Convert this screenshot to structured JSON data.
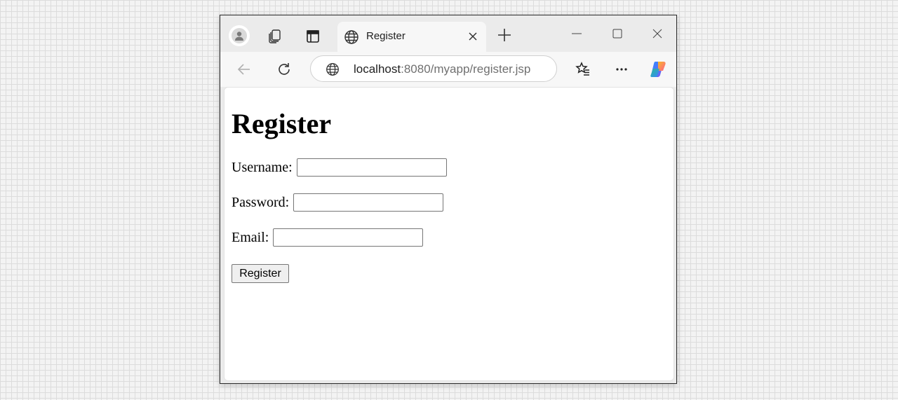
{
  "browser": {
    "tab": {
      "title": "Register"
    },
    "address": {
      "host": "localhost",
      "rest": ":8080/myapp/register.jsp"
    }
  },
  "page": {
    "heading": "Register",
    "fields": [
      {
        "label": "Username:",
        "value": ""
      },
      {
        "label": "Password:",
        "value": ""
      },
      {
        "label": "Email:",
        "value": ""
      }
    ],
    "submit_label": "Register"
  },
  "colors": {
    "window_border": "#2b2b2b",
    "tab_active": "#f7f7f7",
    "copilot_accent": "#7b5cf0"
  },
  "icons": [
    "profile-icon",
    "workspaces-icon",
    "vertical-tabs-icon",
    "globe-icon",
    "close-icon",
    "plus-icon",
    "minimize-icon",
    "maximize-icon",
    "back-icon",
    "refresh-icon",
    "favorites-icon",
    "more-icon",
    "copilot-icon"
  ]
}
